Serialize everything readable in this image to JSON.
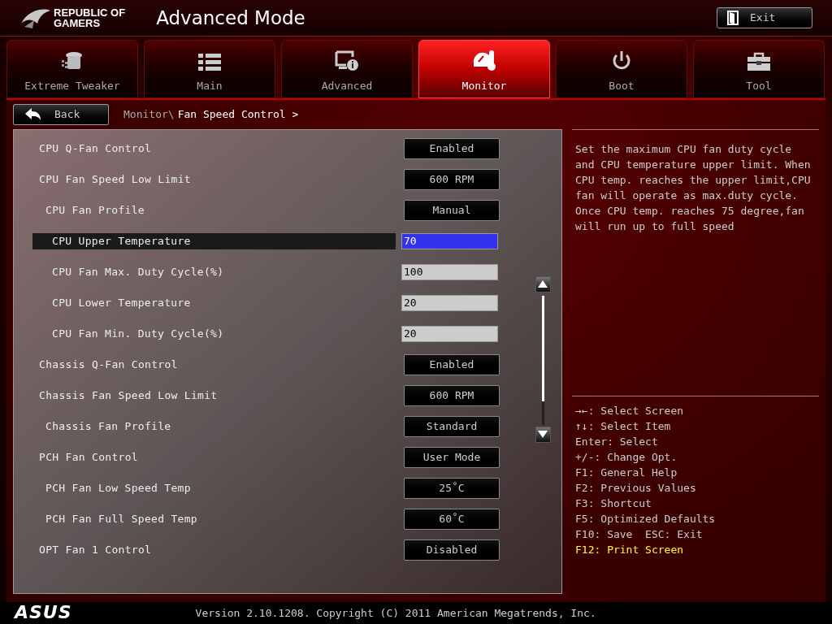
{
  "header": {
    "brand_line_1": "REPUBLIC OF",
    "brand_line_2": "GAMERS",
    "title": "Advanced Mode",
    "exit_button": "Exit"
  },
  "tabs": [
    {
      "label": "Extreme Tweaker",
      "kind": "tweaker",
      "selected": false
    },
    {
      "label": "Main",
      "kind": "list",
      "selected": false
    },
    {
      "label": "Advanced",
      "kind": "advanced",
      "selected": false
    },
    {
      "label": "Monitor",
      "kind": "monitor",
      "selected": true
    },
    {
      "label": "Boot",
      "kind": "power",
      "selected": false
    },
    {
      "label": "Tool",
      "kind": "toolbox",
      "selected": false
    }
  ],
  "back_button": "Back",
  "breadcrumb": {
    "parent": "Monitor\\",
    "current": "Fan Speed Control >"
  },
  "settings": [
    {
      "label": "CPU Q-Fan Control",
      "kind": "option",
      "value": "Enabled",
      "selected": false
    },
    {
      "label": "CPU Fan Speed Low Limit",
      "kind": "option",
      "value": "600 RPM",
      "selected": false,
      "children": [
        {
          "label": "CPU Fan Profile",
          "kind": "option",
          "value": "Manual",
          "selected": false,
          "children": [
            {
              "label": "CPU Upper Temperature",
              "kind": "input",
              "value": "70",
              "selected": true
            },
            {
              "label": "CPU Fan Max. Duty Cycle(%)",
              "kind": "input",
              "value": "100",
              "selected": false
            },
            {
              "label": "CPU Lower Temperature",
              "kind": "input",
              "value": "20",
              "selected": false
            },
            {
              "label": "CPU Fan Min. Duty Cycle(%)",
              "kind": "input",
              "value": "20",
              "selected": false
            }
          ]
        }
      ]
    },
    {
      "label": "Chassis Q-Fan Control",
      "kind": "option",
      "value": "Enabled",
      "selected": false
    },
    {
      "label": "Chassis Fan Speed Low Limit",
      "kind": "option",
      "value": "600 RPM",
      "selected": false,
      "children": [
        {
          "label": "Chassis Fan Profile",
          "kind": "option",
          "value": "Standard",
          "selected": false
        }
      ]
    },
    {
      "label": "PCH Fan Control",
      "kind": "option",
      "value": "User Mode",
      "selected": false,
      "children": [
        {
          "label": "PCH Fan Low Speed Temp",
          "kind": "option",
          "value": "25˚C",
          "selected": false
        },
        {
          "label": "PCH Fan Full Speed Temp",
          "kind": "option",
          "value": "60˚C",
          "selected": false
        }
      ]
    },
    {
      "label": "OPT Fan 1 Control",
      "kind": "option",
      "value": "Disabled",
      "selected": false
    }
  ],
  "help_text": "Set the maximum CPU fan duty cycle and CPU temperature upper limit. When CPU temp. reaches the upper limit,CPU fan will operate as max.duty cycle. Once CPU temp. reaches 75 degree,fan will run up to full speed",
  "key_help": [
    {
      "text": "→←: Select Screen",
      "highlighted": false
    },
    {
      "text": "↑↓: Select Item",
      "highlighted": false
    },
    {
      "text": "Enter: Select",
      "highlighted": false
    },
    {
      "text": "+/-: Change Opt.",
      "highlighted": false
    },
    {
      "text": "F1: General Help",
      "highlighted": false
    },
    {
      "text": "F2: Previous Values",
      "highlighted": false
    },
    {
      "text": "F3: Shortcut",
      "highlighted": false
    },
    {
      "text": "F5: Optimized Defaults",
      "highlighted": false
    },
    {
      "text": "F10: Save  ESC: Exit",
      "highlighted": false
    },
    {
      "text": "F12: Print Screen",
      "highlighted": true
    }
  ],
  "footer": {
    "logo": "ASUS",
    "version": "Version 2.10.1208. Copyright (C) 2011 American Megatrends, Inc."
  }
}
